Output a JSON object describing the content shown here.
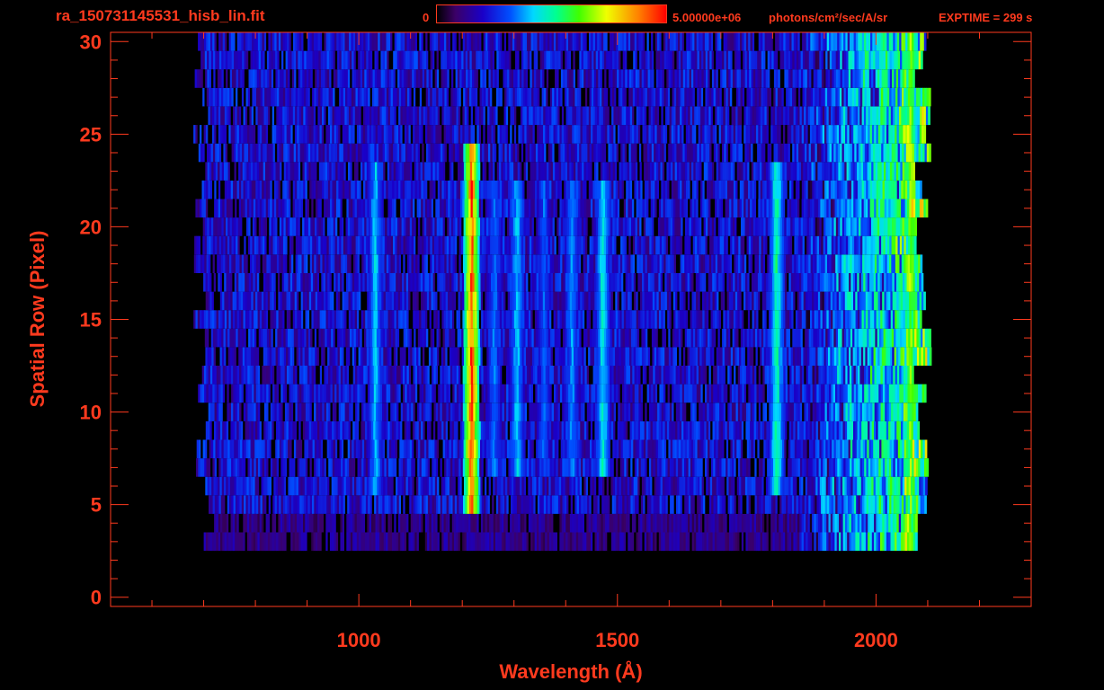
{
  "header": {
    "filename": "ra_150731145531_hisb_lin.fit",
    "colorbar_min": "0",
    "colorbar_max": "5.00000e+06",
    "colorbar_unit": "photons/cm²/sec/A/sr",
    "exptime": "EXPTIME = 299 s"
  },
  "colors": {
    "axis": "#ff3a1e",
    "background": "#000000"
  },
  "chart_data": {
    "type": "heatmap",
    "title": "",
    "xlabel": "Wavelength (Å)",
    "ylabel": "Spatial Row (Pixel)",
    "xlim": [
      520,
      2300
    ],
    "ylim": [
      -0.5,
      30.5
    ],
    "x_ticks": [
      1000,
      1500,
      2000
    ],
    "y_ticks": [
      0,
      5,
      10,
      15,
      20,
      25,
      30
    ],
    "x_tick_labels": [
      "1000",
      "1500",
      "2000"
    ],
    "y_tick_labels": [
      "0",
      "5",
      "10",
      "15",
      "20",
      "25",
      "30"
    ],
    "colorscale": "rainbow",
    "zlim": [
      0,
      5000000
    ],
    "data_extent": {
      "x_min": 690,
      "x_max": 2110,
      "row_min": 3,
      "row_max": 30
    },
    "emission_lines": [
      {
        "wavelength": 1030,
        "rows": [
          6,
          23
        ],
        "relative_intensity": 0.45
      },
      {
        "wavelength": 1216,
        "rows": [
          5,
          24
        ],
        "relative_intensity": 1.0
      },
      {
        "wavelength": 1260,
        "rows": [
          7,
          22
        ],
        "relative_intensity": 0.38
      },
      {
        "wavelength": 1304,
        "rows": [
          7,
          22
        ],
        "relative_intensity": 0.45
      },
      {
        "wavelength": 1356,
        "rows": [
          7,
          22
        ],
        "relative_intensity": 0.35
      },
      {
        "wavelength": 1410,
        "rows": [
          7,
          22
        ],
        "relative_intensity": 0.4
      },
      {
        "wavelength": 1470,
        "rows": [
          7,
          22
        ],
        "relative_intensity": 0.5
      },
      {
        "wavelength": 1806,
        "rows": [
          6,
          23
        ],
        "relative_intensity": 0.55
      },
      {
        "wavelength": 2065,
        "rows": [
          2,
          30
        ],
        "relative_intensity": 0.7
      }
    ]
  }
}
